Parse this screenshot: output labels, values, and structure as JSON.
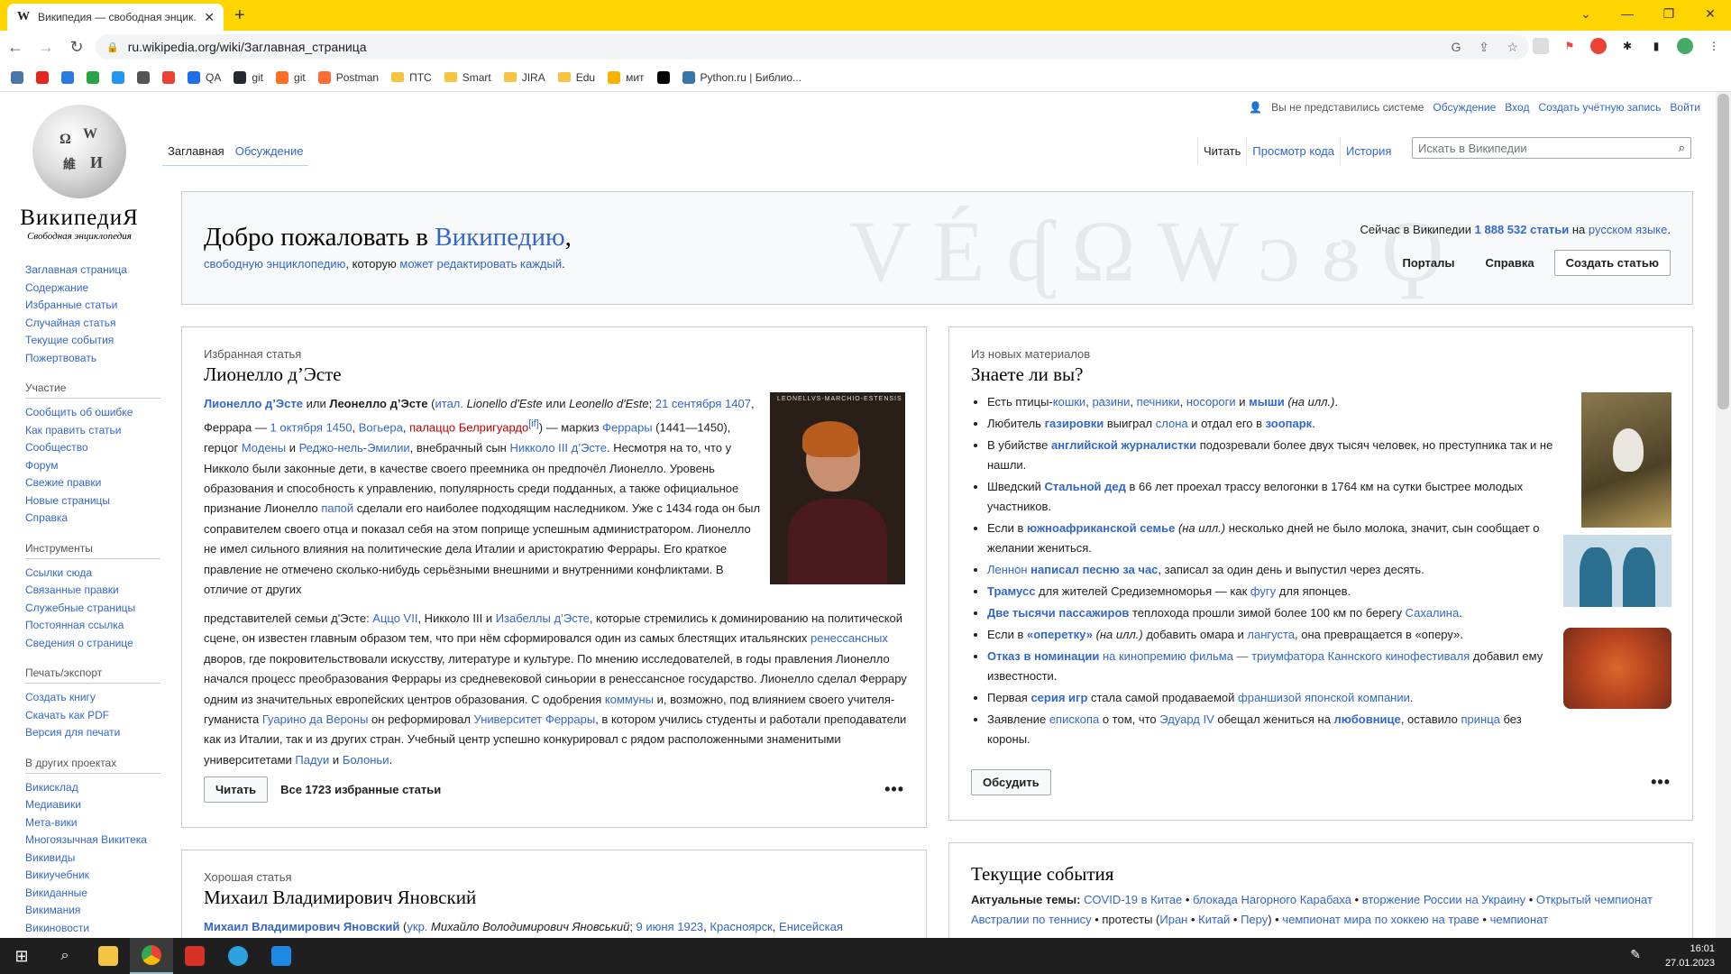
{
  "browser": {
    "tab_title": "Википедия — свободная энцик...",
    "tab_favicon": "W",
    "url": "ru.wikipedia.org/wiki/Заглавная_страница",
    "bookmarks": [
      {
        "label": "",
        "color": "#4a76a8"
      },
      {
        "label": "",
        "color": "#e52620"
      },
      {
        "label": "",
        "color": "#2a7ae2"
      },
      {
        "label": "",
        "color": "#27a348"
      },
      {
        "label": "",
        "color": "#2196f3"
      },
      {
        "label": "",
        "color": "#555555"
      },
      {
        "label": "",
        "color": "#ea4335"
      },
      {
        "label": "QA",
        "color": "#1f6feb"
      },
      {
        "label": "git",
        "color": "#24292f"
      },
      {
        "label": "git",
        "color": "#fc6d26"
      },
      {
        "label": "Postman",
        "color": "#ff6c37"
      },
      {
        "label": "ПТС",
        "folder": true
      },
      {
        "label": "Smart",
        "folder": true
      },
      {
        "label": "JIRA",
        "folder": true
      },
      {
        "label": "Edu",
        "folder": true
      },
      {
        "label": "мит",
        "color": "#f4b400"
      },
      {
        "label": "",
        "color": "#000000"
      },
      {
        "label": "Python.ru | Библио...",
        "color": "#3776ab"
      }
    ]
  },
  "wiki": {
    "logo_word": "ВикипедиЯ",
    "logo_sub": "Свободная энциклопедия",
    "sidebar": {
      "nav": [
        "Заглавная страница",
        "Содержание",
        "Избранные статьи",
        "Случайная статья",
        "Текущие события",
        "Пожертвовать"
      ],
      "participation_h": "Участие",
      "participation": [
        "Сообщить об ошибке",
        "Как править статьи",
        "Сообщество",
        "Форум",
        "Свежие правки",
        "Новые страницы",
        "Справка"
      ],
      "tools_h": "Инструменты",
      "tools": [
        "Ссылки сюда",
        "Связанные правки",
        "Служебные страницы",
        "Постоянная ссылка",
        "Сведения о странице"
      ],
      "print_h": "Печать/экспорт",
      "print": [
        "Создать книгу",
        "Скачать как PDF",
        "Версия для печати"
      ],
      "other_h": "В других проектах",
      "other": [
        "Викисклад",
        "Медиавики",
        "Мета-вики",
        "Многоязычная Викитека",
        "Викивиды",
        "Викиучебник",
        "Викиданные",
        "Викимания",
        "Викиновости"
      ]
    },
    "toplinks": {
      "anon": "Вы не представились системе",
      "talk": "Обсуждение",
      "login": "Вход",
      "create": "Создать учётную запись",
      "logout": "Войти"
    },
    "ns_tabs": [
      "Заглавная",
      "Обсуждение"
    ],
    "view_tabs": [
      "Читать",
      "Просмотр кода",
      "История"
    ],
    "search_placeholder": "Искать в Википедии",
    "welcome": {
      "title_pre": "Добро пожаловать в ",
      "title_link": "Википедию",
      "title_post": ",",
      "sub_link1": "свободную энциклопедию",
      "sub_mid": ", которую ",
      "sub_link2": "может редактировать каждый",
      "sub_end": ".",
      "count_pre": "Сейчас в Википедии ",
      "count_link": "1 888 532 статьи",
      "count_mid": " на ",
      "count_lang": "русском языке",
      "count_end": ".",
      "portals": "Порталы",
      "help": "Справка",
      "create": "Создать статью"
    },
    "featured": {
      "label": "Избранная статья",
      "title": "Лионелло д’Эсте",
      "read": "Читать",
      "all": "Все 1723 избранные статьи",
      "more": "•••",
      "portrait_caption": "LEONELLVS-MARCHIO-ESTENSIS"
    },
    "dyk": {
      "label": "Из новых материалов",
      "title": "Знаете ли вы?",
      "discuss": "Обсудить",
      "more": "•••"
    },
    "good": {
      "label": "Хорошая статья",
      "title": "Михаил Владимирович Яновский"
    },
    "news": {
      "title": "Текущие события",
      "topics_label": "Актуальные темы:"
    }
  },
  "taskbar": {
    "time": "16:01",
    "date": "27.01.2023"
  }
}
